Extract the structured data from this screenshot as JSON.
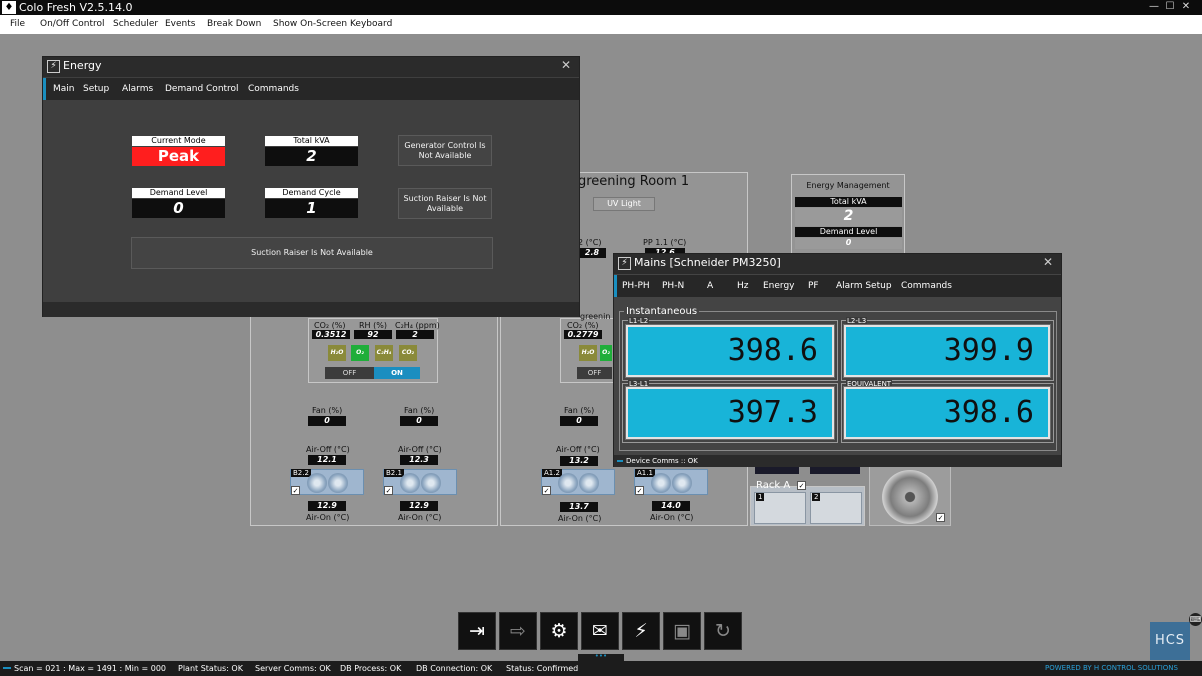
{
  "app": {
    "title": "Colo Fresh V2.5.14.0",
    "icon": "app-logo-icon"
  },
  "window_controls": [
    "—",
    "☐",
    "✕"
  ],
  "menu": [
    "File",
    "On/Off Control",
    "Scheduler",
    "Events",
    "Break Down",
    "Show On-Screen Keyboard"
  ],
  "background": {
    "room_title": "greening Room 1",
    "uv_button": "UV Light",
    "room_labels": {
      "temp": "2 (°C)",
      "pp": "PP 1.1 (°C)",
      "temp_val": "2.8",
      "pp_val": "12.6"
    },
    "energy_mgmt": {
      "title": "Energy Management",
      "kva_label": "Total kVA",
      "kva_value": "2",
      "demand_label": "Demand Level",
      "demand_value": "0"
    },
    "zone1": {
      "sensor_labels": [
        "CO₂ (%)",
        "RH (%)",
        "C₂H₄ (ppm)"
      ],
      "sensor_values": [
        "0.3512",
        "92",
        "2"
      ],
      "chips": [
        "H₂O",
        "O₂",
        "C₂H₄",
        "CO₂"
      ],
      "toggle": [
        "OFF",
        "ON"
      ],
      "fans": [
        {
          "fan_label": "Fan (%)",
          "fan_value": "0",
          "air_off_label": "Air-Off (°C)",
          "air_off": "12.1",
          "tag": "B2.2",
          "air_on": "12.9",
          "air_on_label": "Air-On (°C)"
        },
        {
          "fan_label": "Fan (%)",
          "fan_value": "0",
          "air_off_label": "Air-Off (°C)",
          "air_off": "12.3",
          "tag": "B2.1",
          "air_on": "12.9",
          "air_on_label": "Air-On (°C)"
        }
      ]
    },
    "zone2": {
      "sensor_label": "CO₂ (%)",
      "sensor_value": "0.2779",
      "partial_label": "greenin",
      "chips": [
        "H₂O",
        "O₂"
      ],
      "toggle_off": "OFF",
      "fans": [
        {
          "fan_label": "Fan (%)",
          "fan_value": "0",
          "air_off_label": "Air-Off (°C)",
          "air_off": "13.2",
          "tag": "A1.2",
          "air_on": "13.7",
          "air_on_label": "Air-On (°C)"
        },
        {
          "tag": "A1.1",
          "air_on": "14.0",
          "air_on_label": "Air-On (°C)"
        }
      ]
    },
    "rack": {
      "label": "Rack A",
      "compressors": [
        "1",
        "2"
      ]
    }
  },
  "energy": {
    "title": "Energy",
    "tabs": [
      "Main",
      "Setup",
      "Alarms",
      "Demand Control",
      "Commands"
    ],
    "current_mode_label": "Current Mode",
    "current_mode": "Peak",
    "total_kva_label": "Total kVA",
    "total_kva": "2",
    "demand_level_label": "Demand Level",
    "demand_level": "0",
    "demand_cycle_label": "Demand Cycle",
    "demand_cycle": "1",
    "generator_notice": "Generator Control Is Not Available",
    "suction_notice_small": "Suction Raiser Is Not Available",
    "suction_notice_wide": "Suction Raiser Is Not Available",
    "mode_color": "#ff1e1e"
  },
  "mains": {
    "title": "Mains [Schneider PM3250]",
    "tabs": [
      "PH-PH",
      "PH-N",
      "A",
      "Hz",
      "Energy",
      "PF",
      "Alarm Setup",
      "Commands"
    ],
    "group_label": "Instantaneous",
    "readings": [
      {
        "label": "L1-L2",
        "value": "398.6"
      },
      {
        "label": "L2-L3",
        "value": "399.9"
      },
      {
        "label": "L3-L1",
        "value": "397.3"
      },
      {
        "label": "EQUIVALENT",
        "value": "398.6"
      }
    ],
    "device_comms": "Device Comms :: OK",
    "lcd_color": "#18b4d8"
  },
  "toolbar": [
    "login-icon",
    "logout-icon",
    "user-settings-icon",
    "mail-icon",
    "energy-icon",
    "save-icon",
    "refresh-icon"
  ],
  "toolbar_glyphs": [
    "⇥",
    "⇨",
    "⚙",
    "✉",
    "⚡",
    "▣",
    "↻"
  ],
  "logo": "HCS",
  "status": {
    "scan": "Scan = 021 : Max = 1491 : Min = 000",
    "plant": "Plant Status: OK",
    "server": "Server Comms: OK",
    "db_process": "DB Process:  OK",
    "db_connection": "DB Connection:  OK",
    "status": "Status:  Confirmed",
    "powered_by": "POWERED BY H CONTROL SOLUTIONS"
  }
}
